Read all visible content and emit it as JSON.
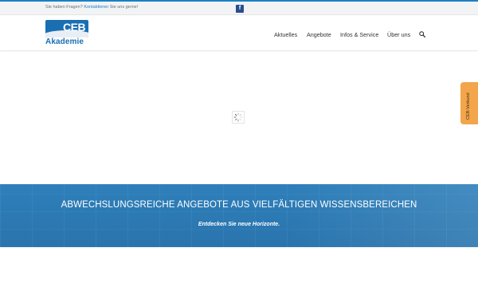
{
  "topbar": {
    "prefix": "Sie haben Fragen?",
    "link": "Kontaktieren",
    "suffix": "Sie uns gerne!",
    "facebook_label": "f"
  },
  "logo": {
    "top": "CEB",
    "bottom": "Akademie"
  },
  "nav": {
    "items": [
      "Aktuelles",
      "Angebote",
      "Infos & Service",
      "Über uns"
    ]
  },
  "banner": {
    "headline": "ABWECHSLUNGSREICHE ANGEBOTE AUS VIELFÄLTIGEN WISSENSBEREICHEN",
    "subline": "Entdecken Sie neue Horizonte."
  },
  "side_tab": {
    "label": "CEB-Verbund"
  },
  "colors": {
    "accent": "#1a7fc4",
    "banner": "#2e7fba",
    "side_tab": "#f2a54a"
  }
}
